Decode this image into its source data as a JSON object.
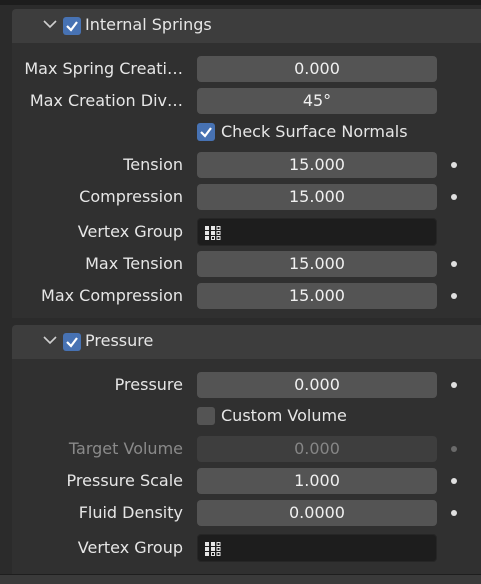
{
  "internal_springs": {
    "title": "Internal Springs",
    "enabled": true,
    "max_spring_creation": {
      "label": "Max Spring Creati…",
      "value": "0.000"
    },
    "max_creation_diversion": {
      "label": "Max Creation Div…",
      "value": "45°"
    },
    "check_surface_normals": {
      "label": "Check Surface Normals",
      "checked": true
    },
    "tension": {
      "label": "Tension",
      "value": "15.000"
    },
    "compression": {
      "label": "Compression",
      "value": "15.000"
    },
    "vertex_group": {
      "label": "Vertex Group",
      "value": ""
    },
    "max_tension": {
      "label": "Max Tension",
      "value": "15.000"
    },
    "max_compression": {
      "label": "Max Compression",
      "value": "15.000"
    }
  },
  "pressure": {
    "title": "Pressure",
    "enabled": true,
    "pressure": {
      "label": "Pressure",
      "value": "0.000"
    },
    "custom_volume": {
      "label": "Custom Volume",
      "checked": false
    },
    "target_volume": {
      "label": "Target Volume",
      "value": "0.000",
      "disabled": true
    },
    "pressure_scale": {
      "label": "Pressure Scale",
      "value": "1.000"
    },
    "fluid_density": {
      "label": "Fluid Density",
      "value": "0.0000"
    },
    "vertex_group": {
      "label": "Vertex Group",
      "value": ""
    }
  },
  "colors": {
    "accent": "#4772b3",
    "panel_header": "#3d3d3d",
    "panel_body": "#303030",
    "field": "#545454",
    "field_dark": "#1d1d1d"
  }
}
